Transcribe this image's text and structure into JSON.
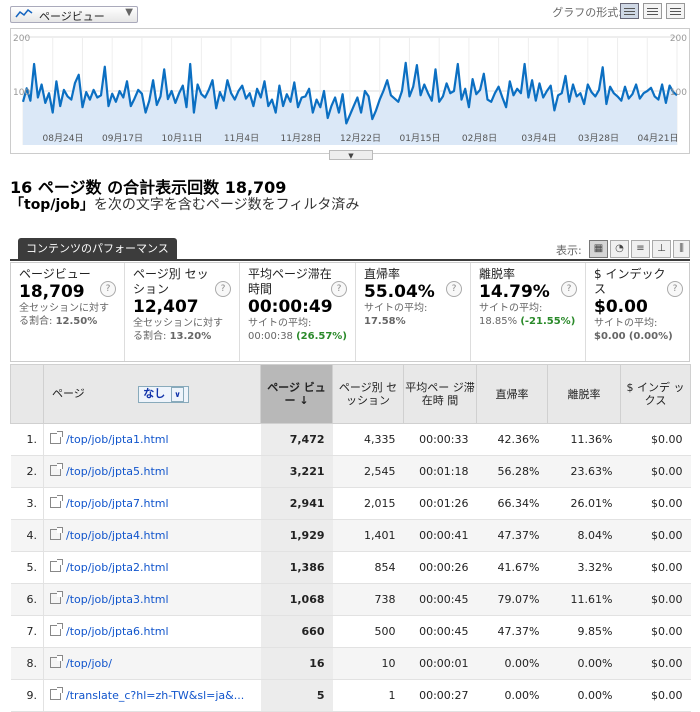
{
  "toolbar": {
    "metric_select": "ページビュー",
    "graph_format_label": "グラフの形式:"
  },
  "chart": {
    "y_max_label": "200",
    "y_mid_label": "100",
    "y_max_label_right": "200",
    "y_mid_label_right": "100",
    "x_labels": [
      "08月24日",
      "09月17日",
      "10月11日",
      "11月4日",
      "11月28日",
      "12月22日",
      "01月15日",
      "02月8日",
      "03月4日",
      "03月28日",
      "04月21日"
    ]
  },
  "chart_data": {
    "type": "area",
    "series": [
      {
        "values": [
          80,
          105,
          82,
          150,
          88,
          112,
          78,
          96,
          60,
          118,
          72,
          102,
          90,
          84,
          115,
          130,
          70,
          98,
          84,
          102,
          88,
          92,
          145,
          72,
          95,
          80,
          100,
          88,
          118,
          72,
          86,
          102,
          95,
          60,
          82,
          120,
          74,
          90,
          140,
          85,
          100,
          78,
          96,
          110,
          70,
          150,
          60,
          112,
          94,
          88,
          102,
          120,
          68,
          98,
          82,
          120,
          96,
          84,
          100,
          110,
          86,
          96,
          72,
          104,
          88,
          118,
          72,
          84,
          60,
          110,
          72,
          94,
          80,
          116,
          70,
          88,
          90,
          104,
          60,
          84,
          70,
          100,
          50,
          72,
          88,
          60,
          94,
          40,
          56,
          72,
          88,
          60,
          100,
          90,
          48,
          64,
          84,
          100,
          120,
          92,
          86,
          80,
          100,
          152,
          90,
          108,
          148,
          92,
          112,
          96,
          82,
          140,
          80,
          90,
          114,
          96,
          100,
          150,
          84,
          104,
          70,
          122,
          94,
          102,
          132,
          84,
          80,
          96,
          108,
          88,
          70,
          118,
          92,
          104,
          96,
          150,
          88,
          120,
          82,
          114,
          88,
          100,
          110,
          64,
          92,
          96,
          128,
          80,
          112,
          90,
          96,
          76,
          112,
          98,
          90,
          102,
          144,
          76,
          108,
          96,
          90,
          82,
          108,
          86,
          94,
          112,
          86,
          96,
          100,
          106,
          90,
          84,
          112,
          78,
          110,
          98,
          92
        ]
      }
    ],
    "ylim": [
      0,
      200
    ],
    "grid": true
  },
  "summary": {
    "count": "16",
    "label": "ページ数 の合計表示回数",
    "total": "18,709"
  },
  "filter_note": {
    "term": "「top/job」",
    "rest": "を次の文字を含むページ数をフィルタ済み"
  },
  "tab": {
    "label": "コンテンツのパフォーマンス"
  },
  "display_label": "表示:",
  "cards": [
    {
      "title": "ページビュー",
      "value": "18,709",
      "sub1": "全セッションに対す",
      "sub2_label": "る割合:",
      "sub2_value": "12.50%",
      "sub2_extra": ""
    },
    {
      "title": "ページ別 セッション",
      "value": "12,407",
      "sub1": "全セッションに対す",
      "sub2_label": "る割合:",
      "sub2_value": "13.20%",
      "sub2_extra": ""
    },
    {
      "title": "平均ページ滞在時間",
      "value": "00:00:49",
      "sub1": "サイトの平均:",
      "sub2_label": "00:00:38",
      "sub2_value": "",
      "sub2_extra": "(26.57%)"
    },
    {
      "title": "直帰率",
      "value": "55.04%",
      "sub1": "サイトの平均:",
      "sub2_label": "",
      "sub2_value": "17.58%",
      "sub2_extra": ""
    },
    {
      "title": "離脱率",
      "value": "14.79%",
      "sub1": "サイトの平均:",
      "sub2_label": "18.85%",
      "sub2_value": "",
      "sub2_extra": "(-21.55%)"
    },
    {
      "title": "$ インデックス",
      "value": "$0.00",
      "sub1": "サイトの平均:",
      "sub2_label": "$0.00",
      "sub2_value": "(0.00%)",
      "sub2_extra": ""
    }
  ],
  "table": {
    "headers": {
      "page": "ページ",
      "dimension": "なし",
      "pageviews": "ページ ビュー",
      "sessions": "ページ別 セッション",
      "avg_time": "平均ペー ジ滞在時 間",
      "bounce": "直帰率",
      "exit": "離脱率",
      "index": "$ インデ ックス"
    },
    "rows": [
      {
        "rank": "1.",
        "page": "/top/job/jpta1.html",
        "pv": "7,472",
        "sess": "4,335",
        "time": "00:00:33",
        "bounce": "42.36%",
        "exit": "11.36%",
        "idx": "$0.00"
      },
      {
        "rank": "2.",
        "page": "/top/job/jpta5.html",
        "pv": "3,221",
        "sess": "2,545",
        "time": "00:01:18",
        "bounce": "56.28%",
        "exit": "23.63%",
        "idx": "$0.00"
      },
      {
        "rank": "3.",
        "page": "/top/job/jpta7.html",
        "pv": "2,941",
        "sess": "2,015",
        "time": "00:01:26",
        "bounce": "66.34%",
        "exit": "26.01%",
        "idx": "$0.00"
      },
      {
        "rank": "4.",
        "page": "/top/job/jpta4.html",
        "pv": "1,929",
        "sess": "1,401",
        "time": "00:00:41",
        "bounce": "47.37%",
        "exit": "8.04%",
        "idx": "$0.00"
      },
      {
        "rank": "5.",
        "page": "/top/job/jpta2.html",
        "pv": "1,386",
        "sess": "854",
        "time": "00:00:26",
        "bounce": "41.67%",
        "exit": "3.32%",
        "idx": "$0.00"
      },
      {
        "rank": "6.",
        "page": "/top/job/jpta3.html",
        "pv": "1,068",
        "sess": "738",
        "time": "00:00:45",
        "bounce": "79.07%",
        "exit": "11.61%",
        "idx": "$0.00"
      },
      {
        "rank": "7.",
        "page": "/top/job/jpta6.html",
        "pv": "660",
        "sess": "500",
        "time": "00:00:45",
        "bounce": "47.37%",
        "exit": "9.85%",
        "idx": "$0.00"
      },
      {
        "rank": "8.",
        "page": "/top/job/",
        "pv": "16",
        "sess": "10",
        "time": "00:00:01",
        "bounce": "0.00%",
        "exit": "0.00%",
        "idx": "$0.00"
      },
      {
        "rank": "9.",
        "page": "/translate_c?hl=zh-TW&sl=ja&...",
        "pv": "5",
        "sess": "1",
        "time": "00:00:27",
        "bounce": "0.00%",
        "exit": "0.00%",
        "idx": "$0.00"
      }
    ]
  }
}
